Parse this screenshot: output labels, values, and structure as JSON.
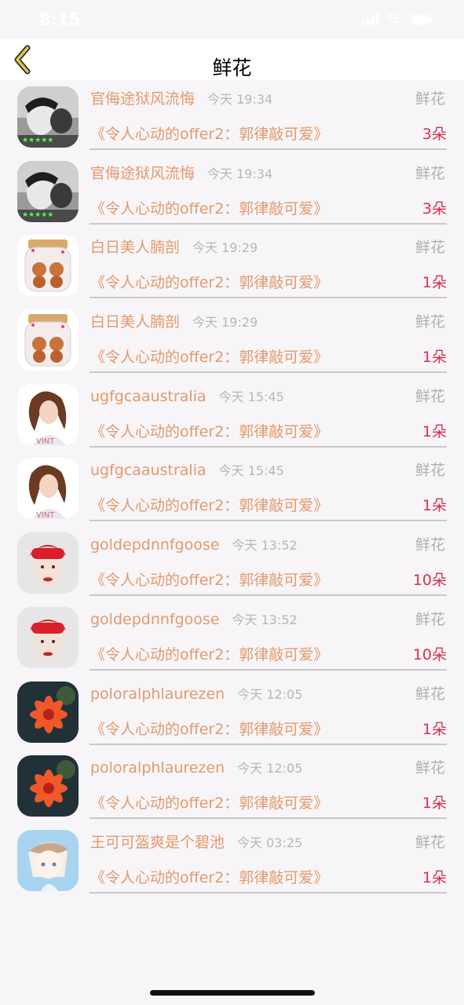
{
  "status_bar": {
    "time": "8:15"
  },
  "nav": {
    "title": "鲜花",
    "back_icon": "chevron-left-icon"
  },
  "colors": {
    "name": "#e39a6b",
    "count": "#d9304a",
    "time": "#b7b7b7",
    "back_icon": "#e0c44a"
  },
  "rows": [
    {
      "avatar": "boy-selfie",
      "name": "官侮途狱风流悔",
      "time": "今天 19:34",
      "label": "鲜花",
      "show": "《令人心动的offer2：郭律敲可爱》",
      "count": "3朵"
    },
    {
      "avatar": "boy-selfie",
      "name": "官侮途狱风流悔",
      "time": "今天 19:34",
      "label": "鲜花",
      "show": "《令人心动的offer2：郭律敲可爱》",
      "count": "3朵"
    },
    {
      "avatar": "bear-jar",
      "name": "白日美人腩剖",
      "time": "今天 19:29",
      "label": "鲜花",
      "show": "《令人心动的offer2：郭律敲可爱》",
      "count": "1朵"
    },
    {
      "avatar": "bear-jar",
      "name": "白日美人腩剖",
      "time": "今天 19:29",
      "label": "鲜花",
      "show": "《令人心动的offer2：郭律敲可爱》",
      "count": "1朵"
    },
    {
      "avatar": "girl-wavy",
      "name": "ugfgcaaustralia",
      "time": "今天 15:45",
      "label": "鲜花",
      "show": "《令人心动的offer2：郭律敲可爱》",
      "count": "1朵"
    },
    {
      "avatar": "girl-wavy",
      "name": "ugfgcaaustralia",
      "time": "今天 15:45",
      "label": "鲜花",
      "show": "《令人心动的offer2：郭律敲可爱》",
      "count": "1朵"
    },
    {
      "avatar": "red-turban",
      "name": "goldepdnnfgoose",
      "time": "今天 13:52",
      "label": "鲜花",
      "show": "《令人心动的offer2：郭律敲可爱》",
      "count": "10朵"
    },
    {
      "avatar": "red-turban",
      "name": "goldepdnnfgoose",
      "time": "今天 13:52",
      "label": "鲜花",
      "show": "《令人心动的offer2：郭律敲可爱》",
      "count": "10朵"
    },
    {
      "avatar": "orange-flower",
      "name": "poloralphlaurezen",
      "time": "今天 12:05",
      "label": "鲜花",
      "show": "《令人心动的offer2：郭律敲可爱》",
      "count": "1朵"
    },
    {
      "avatar": "orange-flower",
      "name": "poloralphlaurezen",
      "time": "今天 12:05",
      "label": "鲜花",
      "show": "《令人心动的offer2：郭律敲可爱》",
      "count": "1朵"
    },
    {
      "avatar": "anime-girl",
      "name": "王可可盔爽是个碧池",
      "time": "今天 03:25",
      "label": "鲜花",
      "show": "《令人心动的offer2：郭律敲可爱》",
      "count": "1朵"
    }
  ]
}
